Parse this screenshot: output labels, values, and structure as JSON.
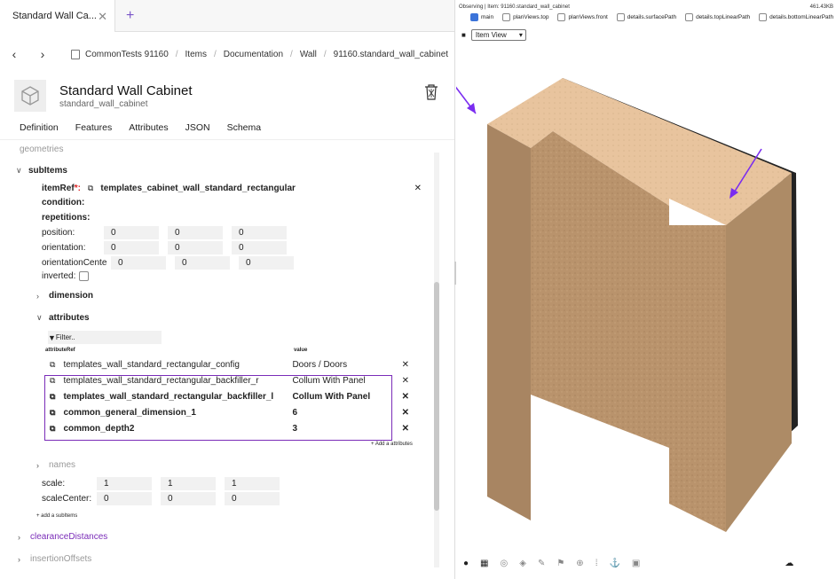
{
  "tab": {
    "title": "Standard Wall Ca...",
    "close": "✕",
    "new": "+"
  },
  "nav": {
    "back": "‹",
    "forward": "›",
    "crumbs": [
      "CommonTests 91160",
      "Items",
      "Documentation",
      "Wall",
      "91160.standard_wall_cabinet"
    ]
  },
  "header": {
    "title": "Standard Wall Cabinet",
    "subtitle": "standard_wall_cabinet"
  },
  "tabs": [
    "Definition",
    "Features",
    "Attributes",
    "JSON",
    "Schema"
  ],
  "tree": {
    "geometries": "geometries",
    "subitems": "subItems",
    "itemref_label": "itemRef",
    "itemref_req": "*:",
    "itemref_value": "templates_cabinet_wall_standard_rectangular",
    "condition": "condition:",
    "repetitions": "repetitions:",
    "position": {
      "label": "position:",
      "values": [
        "0",
        "0",
        "0"
      ]
    },
    "orientation": {
      "label": "orientation:",
      "values": [
        "0",
        "0",
        "0"
      ]
    },
    "orientationCenter": {
      "label": "orientationCente",
      "values": [
        "0",
        "0",
        "0"
      ]
    },
    "inverted": "inverted:",
    "dimension": "dimension",
    "attributes": "attributes",
    "filter": "Filter..",
    "col_attr": "attributeRef",
    "col_value": "value",
    "rows": [
      {
        "ref": "templates_wall_standard_rectangular_config",
        "value": "Doors / Doors"
      },
      {
        "ref": "templates_wall_standard_rectangular_backfiller_r",
        "value": "Collum With Panel"
      },
      {
        "ref": "templates_wall_standard_rectangular_backfiller_l",
        "value": "Collum With Panel"
      },
      {
        "ref": "common_general_dimension_1",
        "value": "6"
      },
      {
        "ref": "common_depth2",
        "value": "3"
      }
    ],
    "add_attributes": "+ Add a attributes",
    "names": "names",
    "scale": {
      "label": "scale:",
      "values": [
        "1",
        "1",
        "1"
      ]
    },
    "scaleCenter": {
      "label": "scaleCenter:",
      "values": [
        "0",
        "0",
        "0"
      ]
    },
    "add_subitems": "+ add a subItems",
    "clearance": "clearanceDistances",
    "insertion": "insertionOffsets"
  },
  "viewer": {
    "observing": "Observing | Item: 91160.standard_wall_cabinet",
    "size": "461.43KB",
    "checks": [
      "main",
      "planViews.top",
      "planViews.front",
      "details.surfacePath",
      "details.topLinearPath",
      "details.bottomLinearPath"
    ],
    "view": "Item View"
  },
  "colors": {
    "accent": "#7a2cb8",
    "wood": "#c09a74"
  }
}
